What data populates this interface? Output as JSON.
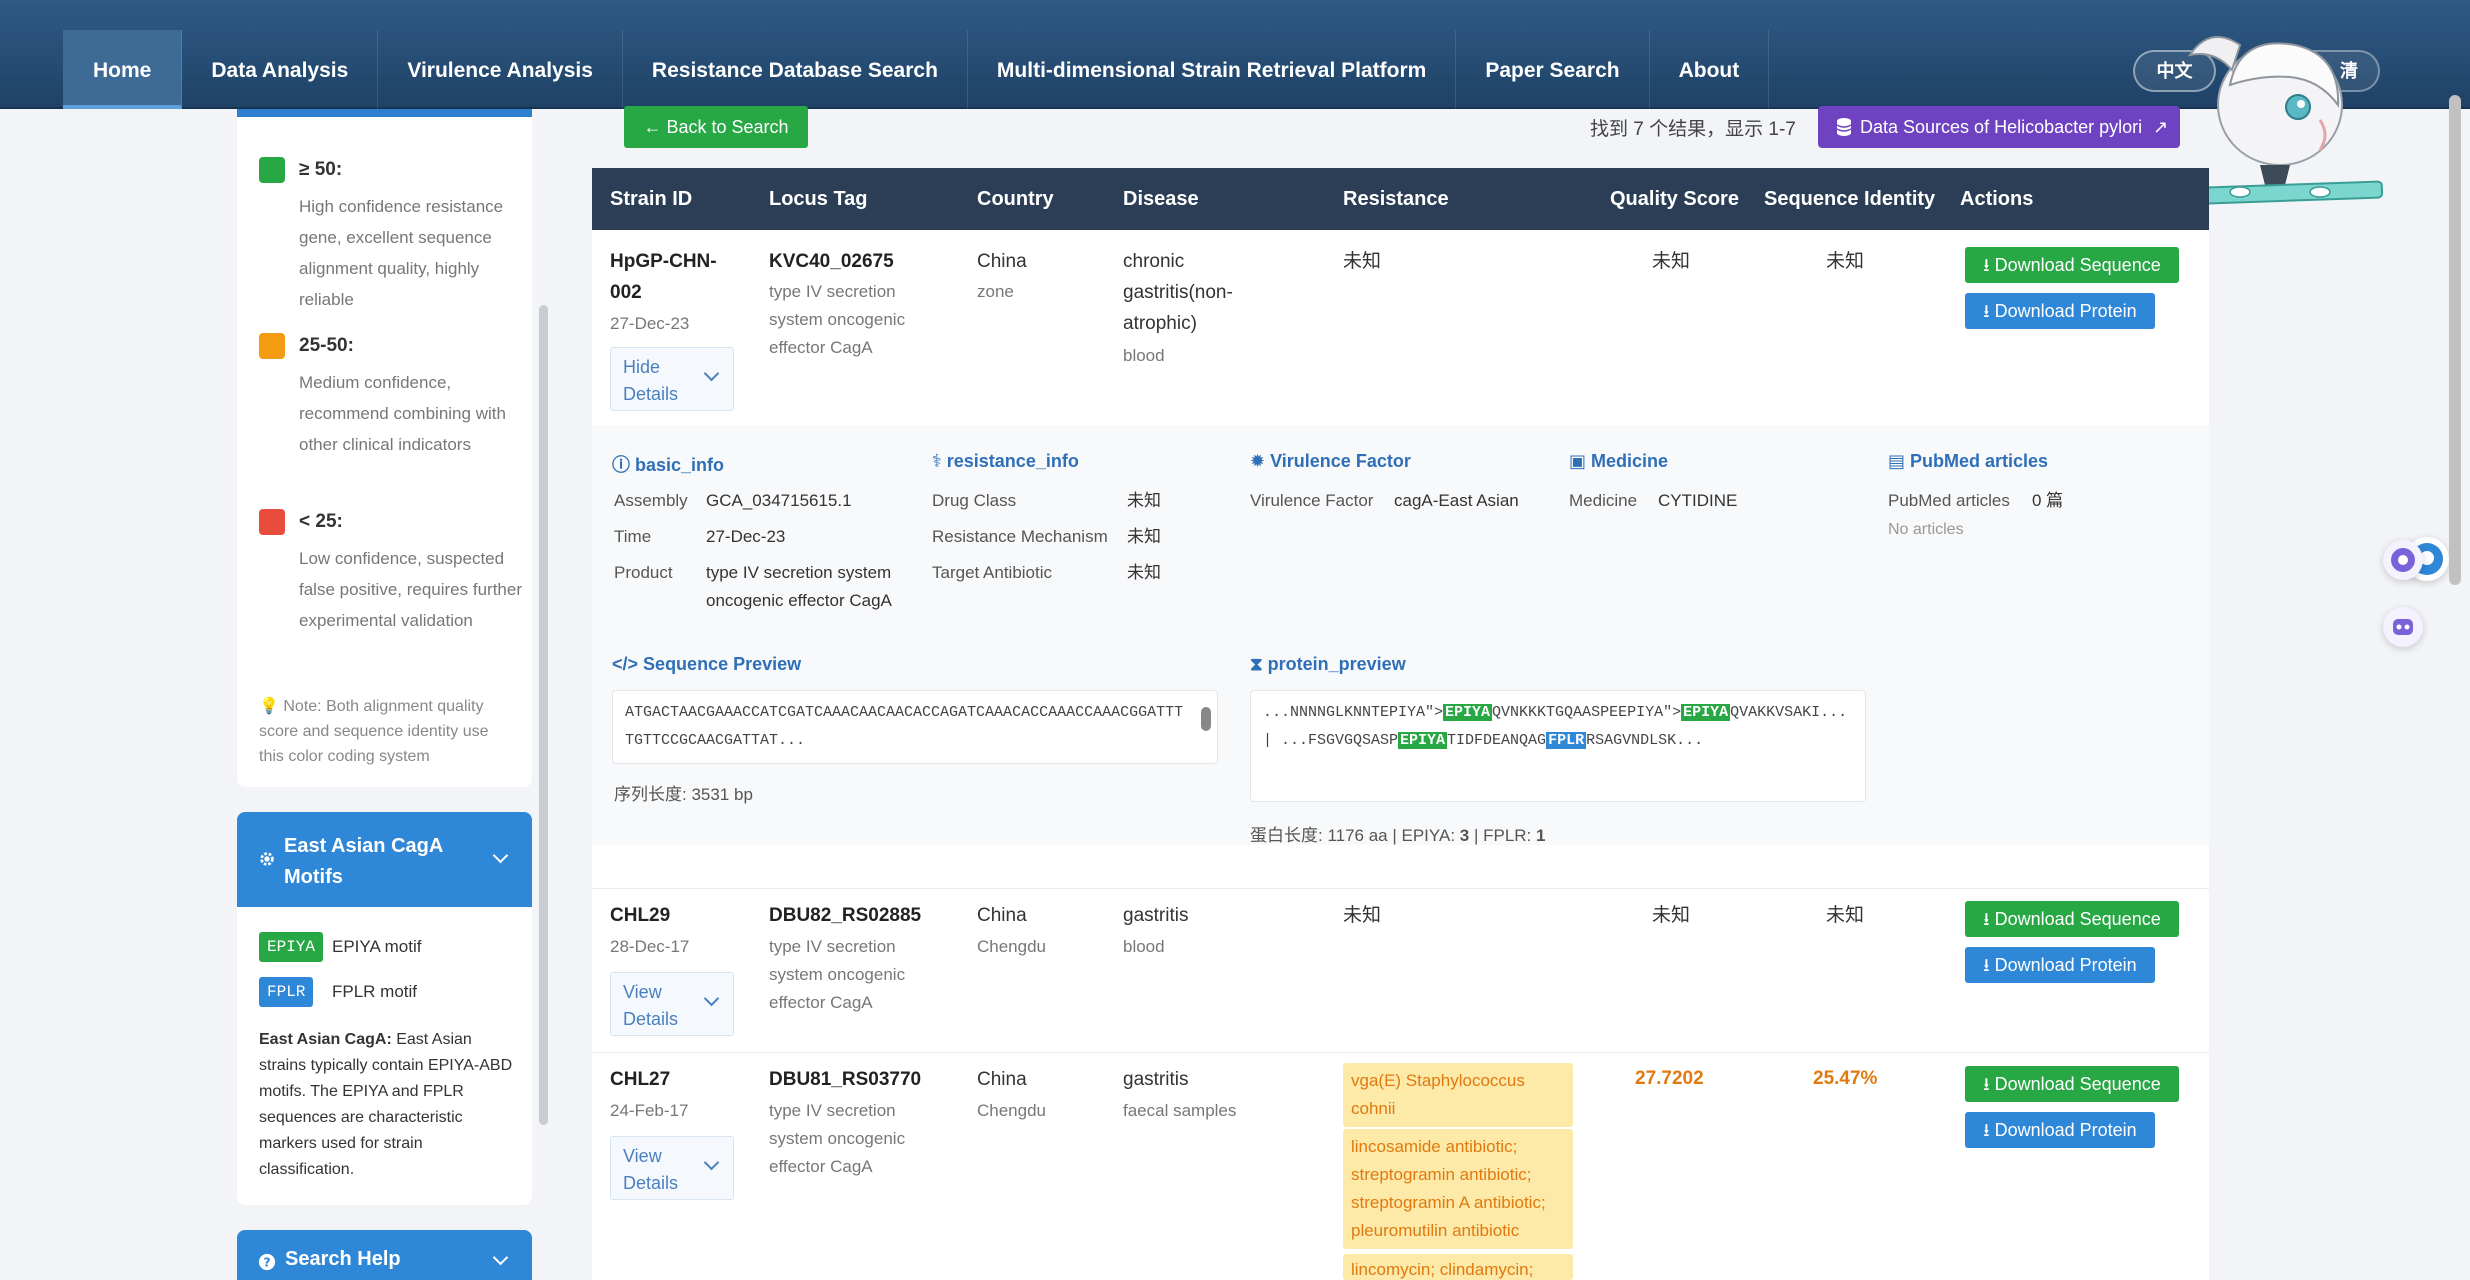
{
  "nav": {
    "items": [
      {
        "label": "Home"
      },
      {
        "label": "Data Analysis"
      },
      {
        "label": "Virulence Analysis"
      },
      {
        "label": "Resistance Database Search"
      },
      {
        "label": "Multi-dimensional Strain Retrieval Platform"
      },
      {
        "label": "Paper Search"
      },
      {
        "label": "About"
      }
    ],
    "lang_label": "中文",
    "extra_label": "清"
  },
  "sidebar": {
    "legend": [
      {
        "title": "≥ 50:",
        "desc": "High confidence resistance gene, excellent sequence alignment quality, highly reliable",
        "color": "#28a745"
      },
      {
        "title": "25-50:",
        "desc": "Medium confidence, recommend combining with other clinical indicators",
        "color": "#f39c12"
      },
      {
        "title": "< 25:",
        "desc": "Low confidence, suspected false positive, requires further experimental validation",
        "color": "#e74c3c"
      }
    ],
    "note": "Note: Both alignment quality score and sequence identity use this color coding system",
    "cag": {
      "title": "East Asian CagA Motifs",
      "epiya_tag": "EPIYA",
      "epiya_label": "EPIYA motif",
      "fplr_tag": "FPLR",
      "fplr_label": "FPLR motif",
      "text_bold": "East Asian CagA:",
      "text": " East Asian strains typically contain EPIYA-ABD motifs. The EPIYA and FPLR sequences are characteristic markers used for strain classification."
    },
    "help_title": "Search Help"
  },
  "toolbar": {
    "back_label": "Back to Search",
    "result_count": "找到 7 个结果，显示 1-7",
    "data_sources_label": "Data Sources of Helicobacter pylori"
  },
  "table": {
    "headers": [
      "Strain ID",
      "Locus Tag",
      "Country",
      "Disease",
      "Resistance",
      "Quality Score",
      "Sequence Identity",
      "Actions"
    ],
    "download_sequence": "Download Sequence",
    "download_protein": "Download Protein",
    "rows": [
      {
        "strain_id": "HpGP-CHN-002",
        "date": "27-Dec-23",
        "detail_btn": "Hide Details",
        "locus_tag": "KVC40_02675",
        "product": "type IV secretion system oncogenic effector CagA",
        "country": "China",
        "region": "zone",
        "disease": "chronic gastritis(non-atrophic)",
        "sample": "blood",
        "resistance": "未知",
        "quality": "未知",
        "identity": "未知"
      },
      {
        "strain_id": "CHL29",
        "date": "28-Dec-17",
        "detail_btn": "View Details",
        "locus_tag": "DBU82_RS02885",
        "product": "type IV secretion system oncogenic effector CagA",
        "country": "China",
        "region": "Chengdu",
        "disease": "gastritis",
        "sample": "blood",
        "resistance": "未知",
        "quality": "未知",
        "identity": "未知"
      },
      {
        "strain_id": "CHL27",
        "date": "24-Feb-17",
        "detail_btn": "View Details",
        "locus_tag": "DBU81_RS03770",
        "product": "type IV secretion system oncogenic effector CagA",
        "country": "China",
        "region": "Chengdu",
        "disease": "gastritis",
        "sample": "faecal samples",
        "resistance_tags": [
          "vga(E) Staphylococcus cohnii",
          "lincosamide antibiotic; streptogramin antibiotic; streptogramin A antibiotic; pleuromutilin antibiotic",
          "lincomycin; clindamycin;"
        ],
        "quality": "27.7202",
        "identity": "25.47%"
      }
    ]
  },
  "details": {
    "basic_info": {
      "title": "basic_info",
      "assembly_k": "Assembly",
      "assembly_v": "GCA_034715615.1",
      "time_k": "Time",
      "time_v": "27-Dec-23",
      "product_k": "Product",
      "product_v": "type IV secretion system oncogenic effector CagA"
    },
    "resistance_info": {
      "title": "resistance_info",
      "drug_k": "Drug Class",
      "drug_v": "未知",
      "mech_k": "Resistance Mechanism",
      "mech_v": "未知",
      "target_k": "Target Antibiotic",
      "target_v": "未知"
    },
    "virulence": {
      "title": "Virulence Factor",
      "k": "Virulence Factor",
      "v": "cagA-East Asian"
    },
    "medicine": {
      "title": "Medicine",
      "k": "Medicine",
      "v": "CYTIDINE"
    },
    "pubmed": {
      "title": "PubMed articles",
      "k": "PubMed articles",
      "v": "0 篇",
      "empty": "No articles"
    },
    "sequence": {
      "title": "Sequence Preview",
      "text": "ATGACTAACGAAACCATCGATCAAACAACAACACCAGATCAAACACCAAACCAAACGGATTTTGTTCCGCAACGATTAT...",
      "length": "序列长度: 3531 bp"
    },
    "protein": {
      "title": "protein_preview",
      "p1": "...NNNNGLKNNTEPIYA\">",
      "m1": "EPIYA",
      "p2": "QVNKKKTGQAASPEEPIYA\">",
      "m2": "EPIYA",
      "p3": "QVAKKVSAKI...  |  ...FSGVGQSASP",
      "m3": "EPIYA",
      "p4": "TIDFDEANQAG",
      "m4": "FPLR",
      "p5": "RSAGVNDLSK...",
      "len_prefix": "蛋白长度: 1176 aa | EPIYA: ",
      "epiya_count": "3",
      "fplr_prefix": " | FPLR: ",
      "fplr_count": "1"
    }
  }
}
